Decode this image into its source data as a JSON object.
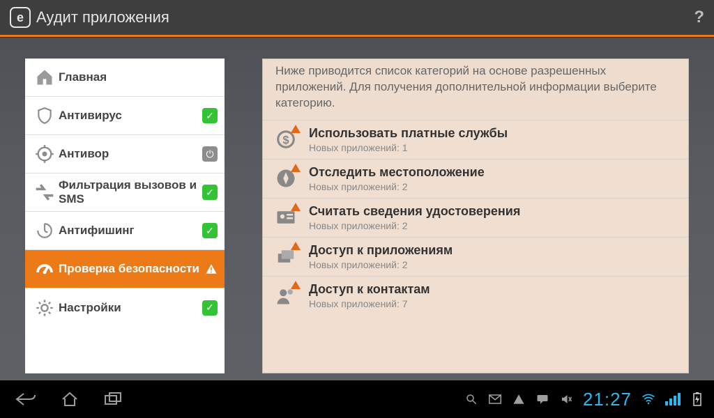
{
  "header": {
    "logo_letter": "e",
    "title": "Аудит приложения",
    "help": "?"
  },
  "sidebar": {
    "items": [
      {
        "label": "Главная",
        "status": "none"
      },
      {
        "label": "Антивирус",
        "status": "ok"
      },
      {
        "label": "Антивор",
        "status": "power"
      },
      {
        "label": "Фильтрация вызовов и SMS",
        "status": "ok"
      },
      {
        "label": "Антифишинг",
        "status": "ok"
      },
      {
        "label": "Проверка безопасности",
        "status": "warn",
        "active": true
      },
      {
        "label": "Настройки",
        "status": "ok"
      }
    ]
  },
  "main": {
    "intro": "Ниже приводится список категорий на основе разрешенных приложений. Для получения дополнительной информации выберите категорию.",
    "sub_prefix": "Новых приложений: ",
    "categories": [
      {
        "title": "Использовать платные службы",
        "count": "1"
      },
      {
        "title": "Отследить местоположение",
        "count": "2"
      },
      {
        "title": "Считать сведения удостоверения",
        "count": "2"
      },
      {
        "title": "Доступ к приложениям",
        "count": "2"
      },
      {
        "title": "Доступ к контактам",
        "count": "7"
      }
    ]
  },
  "status": {
    "clock": "21:27"
  },
  "badges": {
    "ok": "✓",
    "power": "⏻"
  }
}
